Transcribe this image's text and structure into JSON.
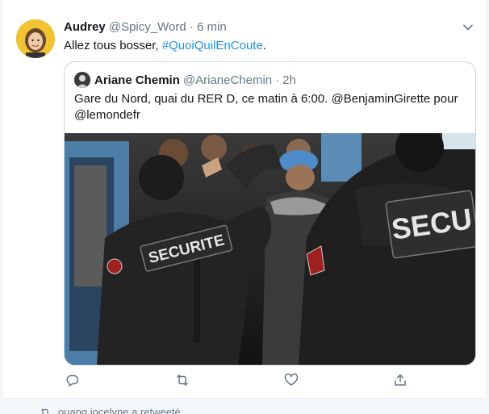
{
  "tweet": {
    "author_name": "Audrey",
    "author_handle": "@Spicy_Word",
    "dot": "·",
    "time": "6 min",
    "text_prefix": "Allez tous bosser, ",
    "hashtag": "#QuoiQuilEnCoute",
    "text_suffix": ".",
    "avatar_icon": "user-avatar-photo"
  },
  "quote": {
    "author_name": "Ariane Chemin",
    "author_handle": "@ArianeChemin",
    "dot": "·",
    "time": "2h",
    "text": "Gare du Nord, quai du RER D, ce matin à 6:00. @BenjaminGirette pour @lemondefr",
    "media": {
      "patch_left": "SECURITE",
      "patch_right": "SECU"
    }
  },
  "actions": {
    "reply_icon": "reply-icon",
    "retweet_icon": "retweet-icon",
    "like_icon": "heart-icon",
    "share_icon": "share-icon"
  },
  "next_item": {
    "text": "ouang jocelyne a retweeté"
  },
  "colors": {
    "link": "#1b95e0",
    "muted": "#657786",
    "border": "#ccd6dd"
  }
}
